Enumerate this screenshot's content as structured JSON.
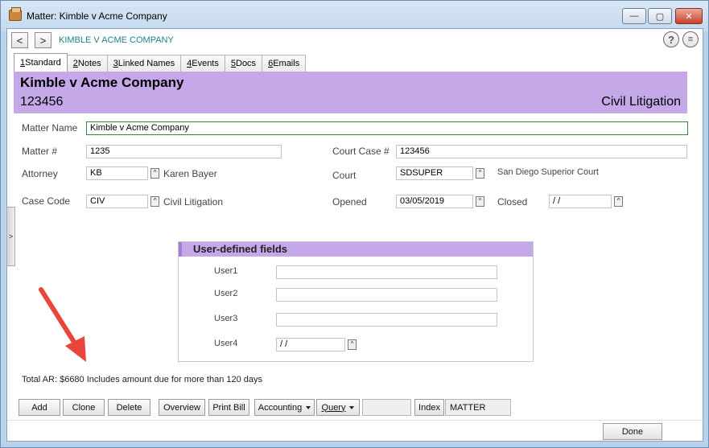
{
  "window": {
    "title": "Matter: Kimble v Acme Company",
    "min_glyph": "—",
    "max_glyph": "▢",
    "close_glyph": "✕"
  },
  "nav": {
    "back_glyph": "<",
    "forward_glyph": ">",
    "breadcrumb": "KIMBLE V ACME COMPANY",
    "help_glyph": "?",
    "menu_glyph": "≡"
  },
  "tabs": [
    {
      "key": "1",
      "label": " Standard"
    },
    {
      "key": "2",
      "label": " Notes"
    },
    {
      "key": "3",
      "label": " Linked Names"
    },
    {
      "key": "4",
      "label": " Events"
    },
    {
      "key": "5",
      "label": " Docs"
    },
    {
      "key": "6",
      "label": " Emails"
    }
  ],
  "header": {
    "name": "Kimble v Acme Company",
    "number": "123456",
    "type": "Civil Litigation"
  },
  "form": {
    "matter_name_label": "Matter Name",
    "matter_name_value": "Kimble v Acme Company",
    "matter_num_label": "Matter #",
    "matter_num_value": "1235",
    "court_case_label": "Court Case #",
    "court_case_value": "123456",
    "attorney_label": "Attorney",
    "attorney_value": "KB",
    "attorney_desc": "Karen Bayer",
    "court_label": "Court",
    "court_value": "SDSUPER",
    "court_desc": "San Diego Superior Court",
    "case_code_label": "Case Code",
    "case_code_value": "CIV",
    "case_code_desc": "Civil Litigation",
    "opened_label": "Opened",
    "opened_value": "03/05/2019",
    "closed_label": "Closed",
    "closed_value": " /  /",
    "spin_glyph": "^"
  },
  "side_tab_glyph": ">",
  "udf": {
    "title": "User-defined fields",
    "user1_label": "User1",
    "user1_value": "",
    "user2_label": "User2",
    "user2_value": "",
    "user3_label": "User3",
    "user3_value": "",
    "user4_label": "User4",
    "user4_value": " /  /"
  },
  "total_ar": "Total AR: $6680 Includes amount due for more than 120 days",
  "buttons": {
    "add": "Add",
    "clone": "Clone",
    "delete": "Delete",
    "overview": "Overview",
    "print_bill": "Print Bill",
    "accounting": "Accounting",
    "query": "Query",
    "query_value": "",
    "index": "Index",
    "index_value": "MATTER",
    "done": "Done"
  },
  "colors": {
    "header_band": "#c4a8e8",
    "accent_teal": "#1d7f8a",
    "annotation_arrow": "#e8453c"
  }
}
